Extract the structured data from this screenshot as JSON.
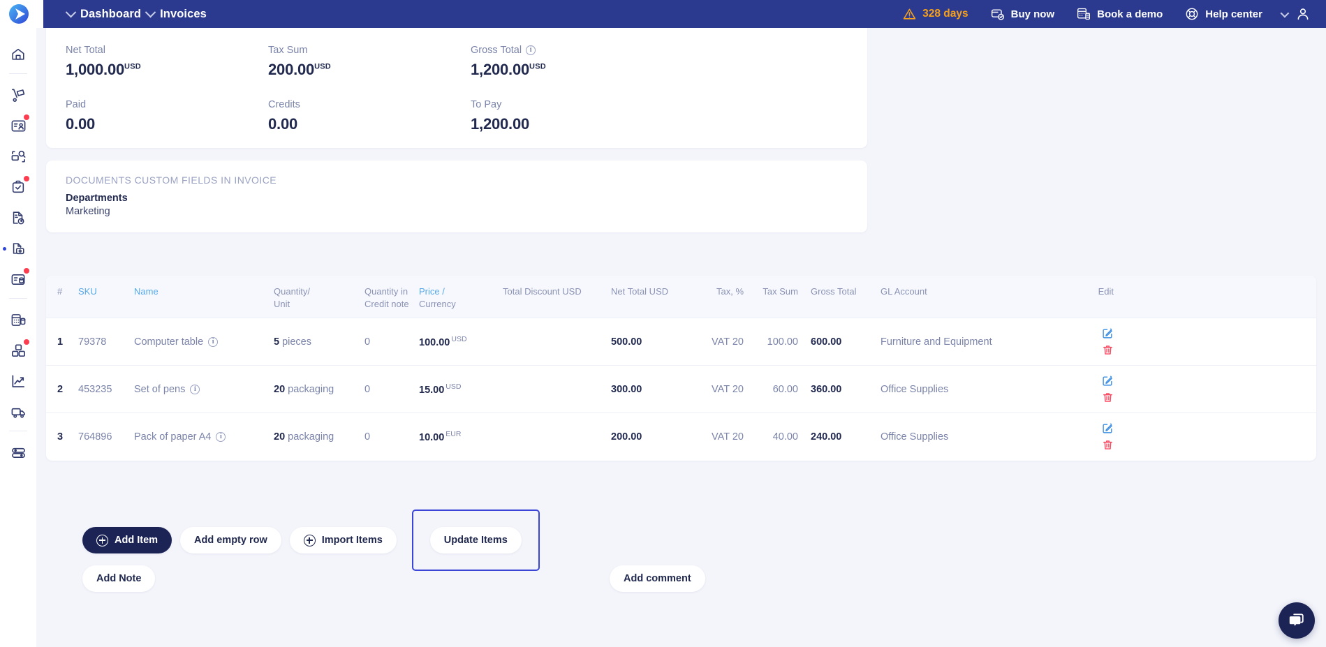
{
  "topbar": {
    "breadcrumbs": [
      {
        "label": "Dashboard"
      },
      {
        "label": "Invoices"
      }
    ],
    "trial_days": "328 days",
    "actions": [
      {
        "label": "Buy now",
        "icon": "card-check-icon"
      },
      {
        "label": "Book a demo",
        "icon": "calculator-icon"
      },
      {
        "label": "Help center",
        "icon": "lifebuoy-icon"
      }
    ],
    "account_icon": "user-icon",
    "caret_icon": "chevron-down-icon",
    "warning_icon": "warning-triangle-icon",
    "accent_warning_color": "#f6a01a",
    "background_color": "#2b3a8f"
  },
  "sidebar": {
    "items": [
      {
        "name": "home",
        "icon": "home-icon",
        "badge": false,
        "active": false
      },
      {
        "name": "purchasing",
        "icon": "hand-truck-icon",
        "badge": false,
        "active": false
      },
      {
        "name": "contacts",
        "icon": "contact-card-icon",
        "badge": true,
        "active": false
      },
      {
        "name": "search-orders",
        "icon": "truck-search-icon",
        "badge": false,
        "active": false
      },
      {
        "name": "approvals",
        "icon": "clipboard-check-icon",
        "badge": true,
        "active": false
      },
      {
        "name": "documents",
        "icon": "document-clock-icon",
        "badge": false,
        "active": false
      },
      {
        "name": "invoices",
        "icon": "document-money-icon",
        "badge": false,
        "active": true
      },
      {
        "name": "accounting",
        "icon": "card-database-icon",
        "badge": true,
        "active": false
      },
      {
        "name": "calculator",
        "icon": "calculator-db-icon",
        "badge": false,
        "active": false
      },
      {
        "name": "inventory",
        "icon": "boxes-icon",
        "badge": true,
        "active": false
      },
      {
        "name": "analytics",
        "icon": "chart-trend-icon",
        "badge": false,
        "active": false
      },
      {
        "name": "shipping",
        "icon": "delivery-truck-icon",
        "badge": false,
        "active": false
      },
      {
        "name": "integrations",
        "icon": "toggles-icon",
        "badge": false,
        "active": false
      }
    ],
    "badge_color": "#fc3d4f",
    "active_marker_color": "#2f45d6"
  },
  "totals": {
    "cells": [
      {
        "label": "Net Total",
        "value": "1,000.00",
        "currency": "USD",
        "info": false
      },
      {
        "label": "Tax Sum",
        "value": "200.00",
        "currency": "USD",
        "info": false
      },
      {
        "label": "Gross Total",
        "value": "1,200.00",
        "currency": "USD",
        "info": true
      },
      {
        "label": "Paid",
        "value": "0.00",
        "currency": "",
        "info": false
      },
      {
        "label": "Credits",
        "value": "0.00",
        "currency": "",
        "info": false
      },
      {
        "label": "To Pay",
        "value": "1,200.00",
        "currency": "",
        "info": false
      }
    ]
  },
  "custom_fields": {
    "title": "DOCUMENTS CUSTOM FIELDS IN INVOICE",
    "key": "Departments",
    "value": "Marketing"
  },
  "items_table": {
    "columns": [
      {
        "id": "idx",
        "line1": "#",
        "line2": "",
        "link1": false,
        "link2": false
      },
      {
        "id": "sku",
        "line1": "SKU",
        "line2": "",
        "link1": true,
        "link2": false
      },
      {
        "id": "name",
        "line1": "Name",
        "line2": "",
        "link1": true,
        "link2": false
      },
      {
        "id": "qty",
        "line1": "Quantity/",
        "line2": "Unit",
        "link1": false,
        "link2": false
      },
      {
        "id": "qcn",
        "line1": "Quantity in",
        "line2": "Credit note",
        "link1": false,
        "link2": false
      },
      {
        "id": "price",
        "line1": "Price /",
        "line2": "Currency",
        "link1": true,
        "link2": false
      },
      {
        "id": "disc",
        "line1": "Total Discount USD",
        "line2": "",
        "link1": false,
        "link2": false
      },
      {
        "id": "net",
        "line1": "Net Total USD",
        "line2": "",
        "link1": false,
        "link2": false
      },
      {
        "id": "tax",
        "line1": "Tax, %",
        "line2": "",
        "link1": false,
        "link2": false
      },
      {
        "id": "tsum",
        "line1": "Tax Sum",
        "line2": "",
        "link1": false,
        "link2": false
      },
      {
        "id": "gross",
        "line1": "Gross Total",
        "line2": "",
        "link1": false,
        "link2": false
      },
      {
        "id": "gl",
        "line1": "GL Account",
        "line2": "",
        "link1": false,
        "link2": false
      },
      {
        "id": "edit",
        "line1": "Edit",
        "line2": "",
        "link1": false,
        "link2": false
      }
    ],
    "rows": [
      {
        "idx": "1",
        "sku": "79378",
        "name": "Computer table",
        "qty": "5",
        "unit": "pieces",
        "qty_credit_note": "0",
        "price": "100.00",
        "currency": "USD",
        "discount": "",
        "net_total": "500.00",
        "tax_pct": "VAT 20",
        "tax_sum": "100.00",
        "gross_total": "600.00",
        "gl_account": "Furniture and Equipment"
      },
      {
        "idx": "2",
        "sku": "453235",
        "name": "Set of pens",
        "qty": "20",
        "unit": "packaging",
        "qty_credit_note": "0",
        "price": "15.00",
        "currency": "USD",
        "discount": "",
        "net_total": "300.00",
        "tax_pct": "VAT 20",
        "tax_sum": "60.00",
        "gross_total": "360.00",
        "gl_account": "Office Supplies"
      },
      {
        "idx": "3",
        "sku": "764896",
        "name": "Pack of paper A4",
        "qty": "20",
        "unit": "packaging",
        "qty_credit_note": "0",
        "price": "10.00",
        "currency": "EUR",
        "discount": "",
        "net_total": "200.00",
        "tax_pct": "VAT 20",
        "tax_sum": "40.00",
        "gross_total": "240.00",
        "gl_account": "Office Supplies"
      }
    ],
    "row_edit_icon": "edit-pencil-icon",
    "row_delete_icon": "trash-icon",
    "edit_icon_color": "#3d8fe0",
    "delete_icon_color": "#f8475f",
    "link_color": "#56a9e8"
  },
  "actions": {
    "add_item": "Add Item",
    "add_empty_row": "Add empty row",
    "import_items": "Import Items",
    "update_items": "Update Items",
    "update_items_focused": true,
    "focus_ring_color": "#3b46d6"
  },
  "footer": {
    "add_note": "Add Note",
    "add_comment": "Add comment"
  },
  "chat": {
    "icon": "chat-bubbles-icon",
    "color": "#1c2456"
  }
}
